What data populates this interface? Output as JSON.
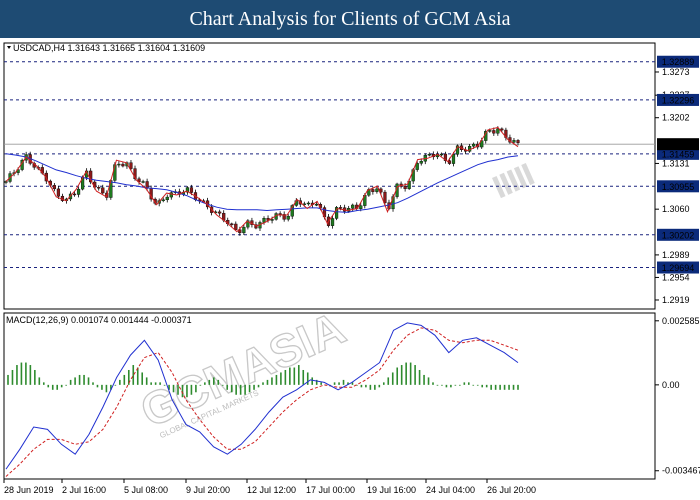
{
  "banner": {
    "title": "Chart Analysis for Clients of GCM Asia"
  },
  "watermark": {
    "brand": "GCMASIA",
    "tagline": "GLOBAL CAPITAL MARKETS"
  },
  "colors": {
    "bull": "#1f7a1f",
    "bear": "#8b1a1a",
    "ma_fast": "#d02020",
    "ma_slow": "#2030d0",
    "level_line": "#1a237e",
    "label_bg": "#0b2a7a",
    "grid": "#1a237e",
    "hist": "#2e8b2e"
  },
  "chart_data": [
    {
      "type": "line",
      "info_line": "USDCAD,H4  1.31643 1.31665 1.31604 1.31609",
      "y_ticks": [
        1.3273,
        1.3237,
        1.3202,
        1.3131,
        1.306,
        1.2989,
        1.2954,
        1.2919
      ],
      "ylim": [
        1.2905,
        1.3318
      ],
      "x_tick_labels": [
        "28 Jun 2019",
        "2 Jul 16:00",
        "5 Jul 08:00",
        "9 Jul 20:00",
        "12 Jul 12:00",
        "17 Jul 00:00",
        "19 Jul 16:00",
        "24 Jul 04:00",
        "26 Jul 20:00"
      ],
      "levels": [
        {
          "value": 1.32889,
          "label": "1.32889"
        },
        {
          "value": 1.32296,
          "label": "1.32296"
        },
        {
          "value": 1.31459,
          "label": "1.31459"
        },
        {
          "value": 1.30955,
          "label": "1.30955"
        },
        {
          "value": 1.30202,
          "label": "1.30202"
        },
        {
          "value": 1.29694,
          "label": "1.29694"
        }
      ],
      "current_price": {
        "value": 1.31609,
        "label": "1.31609"
      },
      "series": [
        {
          "values": [
            1.3103,
            1.3118,
            1.3141,
            1.3128,
            1.3109,
            1.3079,
            1.3073,
            1.3091,
            1.3119,
            1.3088,
            1.3079,
            1.3136,
            1.3132,
            1.3105,
            1.3091,
            1.3067,
            1.3085,
            1.3082,
            1.3088,
            1.3079,
            1.3068,
            1.3051,
            1.3039,
            1.3025,
            1.3041,
            1.3034,
            1.3041,
            1.3051,
            1.3051,
            1.3075,
            1.3061,
            1.3072,
            1.3038,
            1.3061,
            1.3058,
            1.3061,
            1.3089,
            1.3096,
            1.3056,
            1.3095,
            1.3099,
            1.3137,
            1.3139,
            1.3145,
            1.3134,
            1.3157,
            1.3151,
            1.3158,
            1.3183,
            1.3187,
            1.3168,
            1.3157
          ]
        },
        {
          "values": [
            1.3146,
            1.3144,
            1.3141,
            1.3135,
            1.3128,
            1.3121,
            1.3117,
            1.3112,
            1.3108,
            1.3105,
            1.3103,
            1.3101,
            1.3098,
            1.3096,
            1.3093,
            1.3092,
            1.309,
            1.3086,
            1.3081,
            1.3074,
            1.3068,
            1.3063,
            1.306,
            1.3059,
            1.3059,
            1.3059,
            1.3058,
            1.3059,
            1.306,
            1.3061,
            1.3062,
            1.3062,
            1.3058,
            1.3056,
            1.3055,
            1.3058,
            1.306,
            1.3063,
            1.3066,
            1.307,
            1.3077,
            1.3085,
            1.3093,
            1.3101,
            1.3108,
            1.3115,
            1.3122,
            1.3129,
            1.3134,
            1.3137,
            1.3141,
            1.3143
          ]
        }
      ]
    },
    {
      "type": "bar",
      "info_line": "MACD(12,26,9) 0.001074 0.001444 -0.000371",
      "y_ticks": [
        0.002585,
        0.0,
        -0.003467
      ],
      "ylim": [
        -0.0038,
        0.0029
      ],
      "series": [
        {
          "values": [
            -0.0034,
            -0.0026,
            -0.0017,
            -0.0018,
            -0.0024,
            -0.0028,
            -0.002,
            -0.0009,
            0.0003,
            0.0012,
            0.0018,
            0.001,
            -0.0006,
            -0.0016,
            -0.0019,
            -0.0025,
            -0.0028,
            -0.0024,
            -0.0018,
            -0.0011,
            -0.0005,
            -0.0002,
            0.0002,
            0.0001,
            -0.0002,
            0.0001,
            0.0005,
            0.0009,
            0.0022,
            0.0025,
            0.0024,
            0.002,
            0.0013,
            0.0018,
            0.0019,
            0.0016,
            0.0013,
            0.0009
          ]
        },
        {
          "values": [
            -0.0037,
            -0.0032,
            -0.0026,
            -0.0022,
            -0.0022,
            -0.0024,
            -0.0023,
            -0.0018,
            -0.0009,
            0.0002,
            0.0011,
            0.0013,
            0.0005,
            -0.0006,
            -0.0014,
            -0.0021,
            -0.0026,
            -0.0026,
            -0.0023,
            -0.0017,
            -0.0011,
            -0.0006,
            -0.0002,
            0.0,
            -0.0001,
            -0.0001,
            0.0002,
            0.0006,
            0.0014,
            0.002,
            0.0023,
            0.0022,
            0.0018,
            0.0017,
            0.0018,
            0.0018,
            0.0016,
            0.0014
          ]
        },
        {
          "values": [
            0.0004,
            0.0006,
            0.0008,
            0.0009,
            0.0009,
            0.0008,
            0.0006,
            0.0003,
            0.0001,
            -0.0001,
            -0.0002,
            -0.0002,
            -0.0001,
            0.0,
            0.0002,
            0.0003,
            0.0004,
            0.0004,
            0.0003,
            0.0001,
            -0.0001,
            -0.0002,
            -0.0003,
            -0.0002,
            0.0,
            0.0002,
            0.0004,
            0.0006,
            0.0008,
            0.0007,
            0.0005,
            0.0003,
            0.0001,
            0.0001,
            0.0001,
            0.0,
            -0.0002,
            -0.0003,
            -0.0004,
            -0.0005,
            -0.0005,
            -0.0004,
            -0.0003,
            0.0,
            0.0001,
            0.0002,
            0.0003,
            0.0002,
            0.0,
            -0.0002,
            -0.0003,
            -0.0004,
            -0.0004,
            -0.0004,
            -0.0003,
            -0.0002,
            -0.0001,
            0.0001,
            0.0002,
            0.0003,
            0.0004,
            0.0005,
            0.0006,
            0.0007,
            0.0007,
            0.0008,
            0.0006,
            0.0005,
            0.0003,
            0.0002,
            0.0001,
            0.0,
            0.0,
            0.0001,
            0.0001,
            0.0002,
            0.0001,
            0.0001,
            0.0,
            -0.0001,
            -0.0001,
            -0.0002,
            -0.0002,
            -0.0001,
            0.0001,
            0.0003,
            0.0005,
            0.0007,
            0.0008,
            0.0009,
            0.0009,
            0.0008,
            0.0006,
            0.0004,
            0.0003,
            0.0001,
            0.0,
            0.0,
            -0.0001,
            -0.0001,
            0.0,
            0.0,
            0.0001,
            0.0001,
            0.0,
            0.0,
            -0.0001,
            -0.0001,
            -0.0002,
            -0.0002,
            -0.0002,
            -0.0002,
            -0.0002,
            -0.0002,
            -0.0002
          ]
        }
      ]
    }
  ]
}
